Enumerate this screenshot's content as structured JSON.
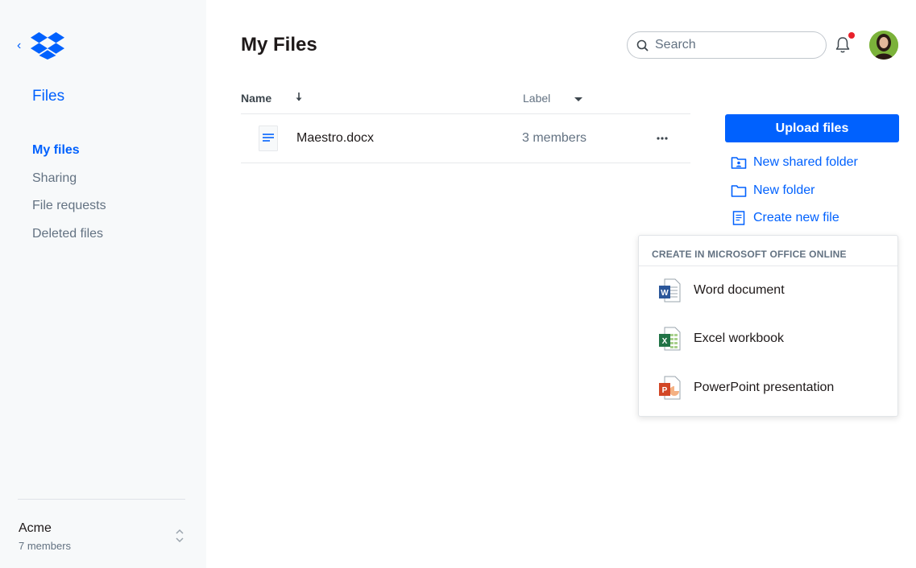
{
  "sidebar": {
    "section_title": "Files",
    "items": [
      {
        "label": "My files",
        "active": true
      },
      {
        "label": "Sharing"
      },
      {
        "label": "File requests"
      },
      {
        "label": "Deleted files"
      }
    ],
    "team": {
      "name": "Acme",
      "members": "7 members"
    }
  },
  "header": {
    "title": "My Files",
    "search_placeholder": "Search",
    "notification_icon": "bell-icon"
  },
  "table": {
    "columns": {
      "name": "Name",
      "label": "Label"
    },
    "rows": [
      {
        "name": "Maestro.docx",
        "label": "3 members",
        "icon": "document-icon"
      }
    ]
  },
  "actions": {
    "upload_label": "Upload files",
    "new_shared_folder": "New shared folder",
    "new_folder": "New folder",
    "create_new_file": "Create new file"
  },
  "create_menu": {
    "header": "CREATE IN MICROSOFT OFFICE ONLINE",
    "items": [
      {
        "label": "Word document",
        "icon": "word-icon"
      },
      {
        "label": "Excel workbook",
        "icon": "excel-icon"
      },
      {
        "label": "PowerPoint presentation",
        "icon": "powerpoint-icon"
      }
    ]
  },
  "colors": {
    "accent": "#0061fe",
    "sidebar_bg": "#f7f9fa",
    "notification": "#e8212b",
    "word": "#2b579a",
    "excel": "#217346",
    "powerpoint": "#d24726"
  }
}
